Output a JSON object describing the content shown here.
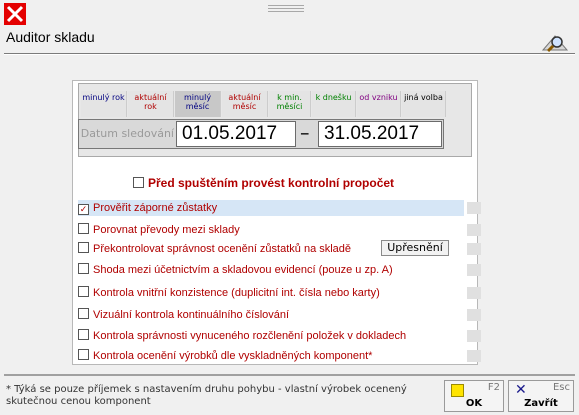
{
  "window": {
    "title": "Auditor skladu",
    "close_icon": "close-icon",
    "tool_icon": "magnifier-tool-icon"
  },
  "period_tabs": [
    {
      "label": "minulý rok",
      "color": "#000080",
      "active": false
    },
    {
      "label": "aktuální rok",
      "color": "#b00000",
      "active": false
    },
    {
      "label": "minulý měsíc",
      "color": "#000080",
      "active": true
    },
    {
      "label": "aktuální měsíc",
      "color": "#b00000",
      "active": false
    },
    {
      "label": "k min. měsíci",
      "color": "#008000",
      "active": false
    },
    {
      "label": "k dnešku",
      "color": "#008000",
      "active": false
    },
    {
      "label": "od vzniku",
      "color": "#800080",
      "active": false
    },
    {
      "label": "jiná volba",
      "color": "#000000",
      "active": false
    }
  ],
  "date": {
    "label": "Datum sledování",
    "from": "01.05.2017",
    "separator": "–",
    "to": "31.05.2017"
  },
  "pre_check": {
    "label": "Před spuštěním provést kontrolní propočet",
    "checked": false
  },
  "checks": [
    {
      "label": "Prověřit záporné zůstatky",
      "checked": true
    },
    {
      "label": "Porovnat převody mezi sklady",
      "checked": false
    },
    {
      "label": "Překontrolovat správnost ocenění zůstatků na skladě",
      "checked": false
    },
    {
      "label": "Shoda mezi účetnictvím a skladovou evidencí (pouze u zp. A)",
      "checked": false
    },
    {
      "label": "Kontrola vnitřní konzistence (duplicitní int. čísla nebo karty)",
      "checked": false
    },
    {
      "label": "Vizuální kontrola kontinuálního číslování",
      "checked": false
    },
    {
      "label": "Kontrola správnosti vynuceného rozčlenění položek v dokladech",
      "checked": false
    },
    {
      "label": "Kontrola ocenění výrobků dle vyskladněných komponent*",
      "checked": false
    }
  ],
  "detail_button": "Upřesnění",
  "footer": {
    "note": "* Týká se pouze příjemek s nastavením druhu pohybu - vlastní výrobek ocenený skutečnou cenou komponent",
    "ok": {
      "key": "F2",
      "label": "OK"
    },
    "close": {
      "key": "Esc",
      "label": "Zavřít"
    }
  }
}
